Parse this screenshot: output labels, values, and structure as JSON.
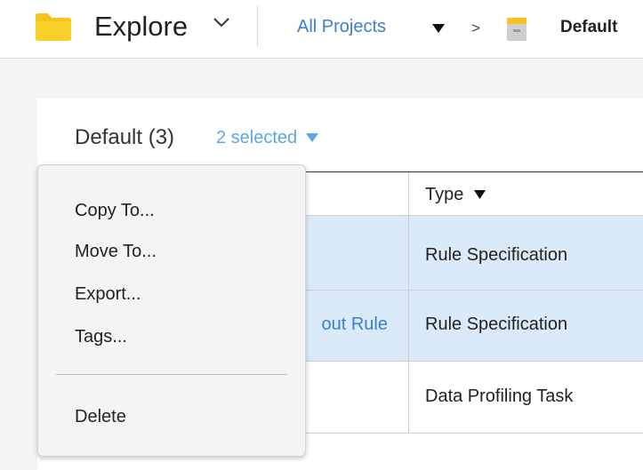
{
  "header": {
    "app_title": "Explore",
    "breadcrumb_root": "All Projects",
    "breadcrumb_separator": ">",
    "breadcrumb_current": "Default"
  },
  "panel": {
    "title": "Default",
    "count": "(3)",
    "selected_label": "2 selected"
  },
  "table": {
    "type_header": "Type",
    "rows": [
      {
        "name": "",
        "type": "Rule Specification",
        "selected": true
      },
      {
        "name": "out Rule",
        "type": "Rule Specification",
        "selected": true
      },
      {
        "name": "",
        "type": "Data Profiling Task",
        "selected": false
      }
    ]
  },
  "menu": {
    "items": [
      "Copy To...",
      "Move To...",
      "Export...",
      "Tags..."
    ],
    "delete_label": "Delete"
  },
  "colors": {
    "accent_blue": "#3a7fd0",
    "light_blue": "#5aa8e8",
    "selected_row": "#dbeaf9",
    "folder_yellow": "#f7c31b"
  },
  "icons": [
    "folder-icon",
    "chevron-down-icon",
    "caret-down-icon",
    "project-icon"
  ]
}
